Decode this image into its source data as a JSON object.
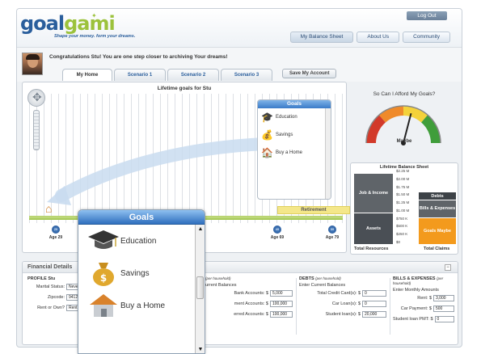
{
  "header": {
    "logo_goal": "goal",
    "logo_gami": "gami",
    "tagline": "Shape your money. form your dreams.",
    "logout": "Log Out",
    "nav": [
      "My Balance Sheet",
      "About Us",
      "Community"
    ]
  },
  "welcome": {
    "message": "Congratulations Stu! You are one step closer to archiving Your dreams!"
  },
  "subtabs": {
    "tabs": [
      "My Home",
      "Scenario 1",
      "Scenario 2",
      "Scenario 3"
    ],
    "save_account": "Save My Account"
  },
  "lifetime_chart": {
    "title": "Lifetime goals for Stu",
    "retirement_label": "Retirement",
    "age_markers": [
      {
        "badge": "29",
        "label": "Age 29"
      },
      {
        "badge": "49",
        "label": "Age 69"
      },
      {
        "badge": "59",
        "label": "Age 79"
      }
    ]
  },
  "goals_panel": {
    "title": "Goals",
    "items": [
      {
        "label": "Education",
        "icon": "graduation-cap-icon"
      },
      {
        "label": "Savings",
        "icon": "money-bag-icon"
      },
      {
        "label": "Buy a Home",
        "icon": "house-icon"
      }
    ]
  },
  "gauge": {
    "title": "So Can I Afford My Goals?",
    "reading": "Maybe",
    "needle_fraction": 0.58
  },
  "chart_data": {
    "type": "bar",
    "title": "Lifetime Balance Sheet",
    "yticks": [
      "$2.25 M",
      "$2.00 M",
      "$1.75 M",
      "$1.50 M",
      "$1.25 M",
      "$1.00 M",
      "$750 K",
      "$500 K",
      "$250 K",
      "$0"
    ],
    "ylim": [
      0,
      2.25
    ],
    "categories": [
      "Total Resources",
      "Total Claims"
    ],
    "series": [
      {
        "name": "Assets",
        "stack": "Total Resources",
        "values": [
          1.0,
          0
        ],
        "color": "#4a4f55"
      },
      {
        "name": "Job & Income",
        "stack": "Total Resources",
        "values": [
          1.25,
          0
        ],
        "color": "#5f6469"
      },
      {
        "name": "Goals Maybe",
        "stack": "Total Claims",
        "values": [
          0,
          0.85
        ],
        "color": "#f39a1d"
      },
      {
        "name": "Bills & Expenses",
        "stack": "Total Claims",
        "values": [
          0,
          0.55
        ],
        "color": "#5f6469"
      },
      {
        "name": "Debts",
        "stack": "Total Claims",
        "values": [
          0,
          0.25
        ],
        "color": "#3d4247"
      }
    ]
  },
  "financial": {
    "title": "Financial Details",
    "profile": {
      "title": "PROFILE Stu",
      "rows": [
        {
          "label": "Marital Status:",
          "value": "Never"
        },
        {
          "label": "Zipcode:",
          "value": "94122"
        },
        {
          "label": "Rent or Own?",
          "value": "Rent"
        }
      ]
    },
    "assets": {
      "title_hh": "(per household)",
      "sub": "urrent Balances",
      "rows": [
        {
          "label": "Bank Accounts: $",
          "value": "5,000"
        },
        {
          "label": "ment Accounts: $",
          "value": "100,000"
        },
        {
          "label": "erred Accounts: $",
          "value": "100,000"
        }
      ]
    },
    "debts": {
      "title": "DEBTS",
      "title_hh": "(per household)",
      "sub": "Enter Current Balances",
      "rows": [
        {
          "label": "Total Credit Card(s): $",
          "value": "0"
        },
        {
          "label": "Car Loan(s): $",
          "value": "0"
        },
        {
          "label": "Student loan(s): $",
          "value": "20,000"
        }
      ]
    },
    "bills": {
      "title": "BILLS & EXPENSES",
      "title_hh": "(per household)",
      "sub": "Enter Monthly Amounts",
      "rows": [
        {
          "label": "Rent: $",
          "value": "3,000"
        },
        {
          "label": "Car Payment: $",
          "value": "500"
        },
        {
          "label": "Student loan PMT: $",
          "value": "0"
        }
      ]
    }
  }
}
